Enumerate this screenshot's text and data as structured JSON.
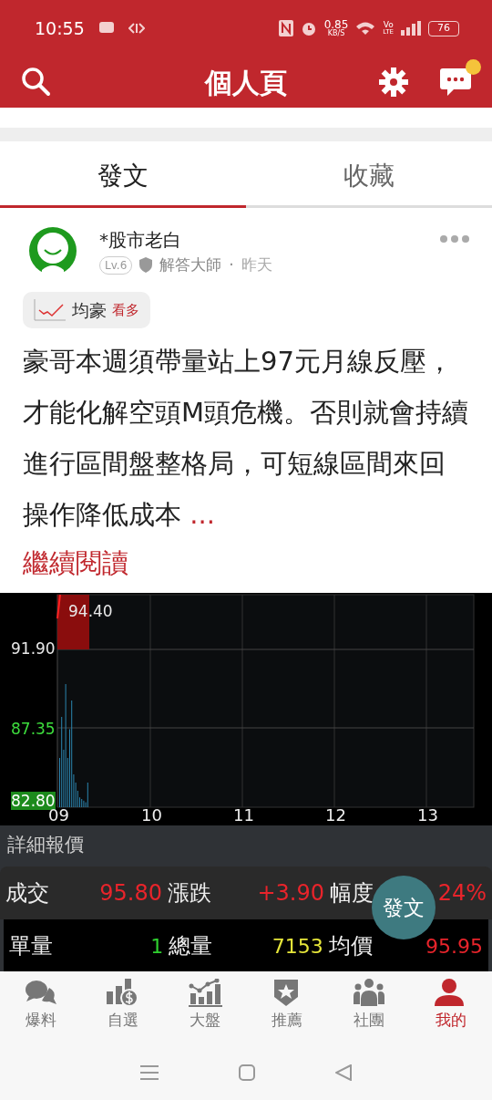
{
  "status_bar": {
    "time": "10:55",
    "net_speed": "0.85",
    "net_unit": "KB/S",
    "volte_top": "Vo",
    "volte_bottom": "LTE",
    "battery": "76"
  },
  "header": {
    "title": "個人頁",
    "has_notification": true
  },
  "tabs": [
    {
      "label": "發文",
      "selected": true
    },
    {
      "label": "收藏",
      "selected": false
    }
  ],
  "post": {
    "author": "*股市老白",
    "level": "Lv.6",
    "role": "解答大師",
    "separator": "·",
    "time": "昨天",
    "stock": {
      "name": "均豪",
      "sentiment": "看多"
    },
    "body": "豪哥本週須帶量站上97元月線反壓，才能化解空頭M頭危機。否則就會持續進行區間盤整格局，可短線區間來回操作降低成本",
    "ellipsis": "...",
    "read_more": "繼續閱讀"
  },
  "chart": {
    "y_labels": [
      {
        "text": "94.40",
        "color": "#e8e8e8"
      },
      {
        "text": "91.90",
        "color": "#e8e8e8"
      },
      {
        "text": "87.35",
        "color": "#3ddc3d"
      },
      {
        "text": "82.80",
        "highlighted": true
      }
    ],
    "x_labels": [
      "09",
      "10",
      "11",
      "12",
      "13"
    ]
  },
  "quote": {
    "title": "詳細報價",
    "rows": [
      [
        {
          "label": "成交",
          "value": "95.80",
          "color": "#e8242b"
        },
        {
          "label": "漲跌",
          "value": "+3.90",
          "color": "#e8242b"
        },
        {
          "label": "幅度",
          "value": "24%",
          "color": "#e8242b"
        }
      ],
      [
        {
          "label": "單量",
          "value": "1",
          "color": "#2fd02f"
        },
        {
          "label": "總量",
          "value": "7153",
          "color": "#e6e63a"
        },
        {
          "label": "均價",
          "value": "95.95",
          "color": "#e8242b"
        }
      ]
    ]
  },
  "fab": {
    "label": "發文"
  },
  "bottom_nav": [
    {
      "label": "爆料",
      "kind": "chat",
      "selected": false
    },
    {
      "label": "自選",
      "kind": "coins",
      "selected": false
    },
    {
      "label": "大盤",
      "kind": "chart",
      "selected": false
    },
    {
      "label": "推薦",
      "kind": "badge",
      "selected": false
    },
    {
      "label": "社團",
      "kind": "group",
      "selected": false
    },
    {
      "label": "我的",
      "kind": "person",
      "selected": true
    }
  ]
}
